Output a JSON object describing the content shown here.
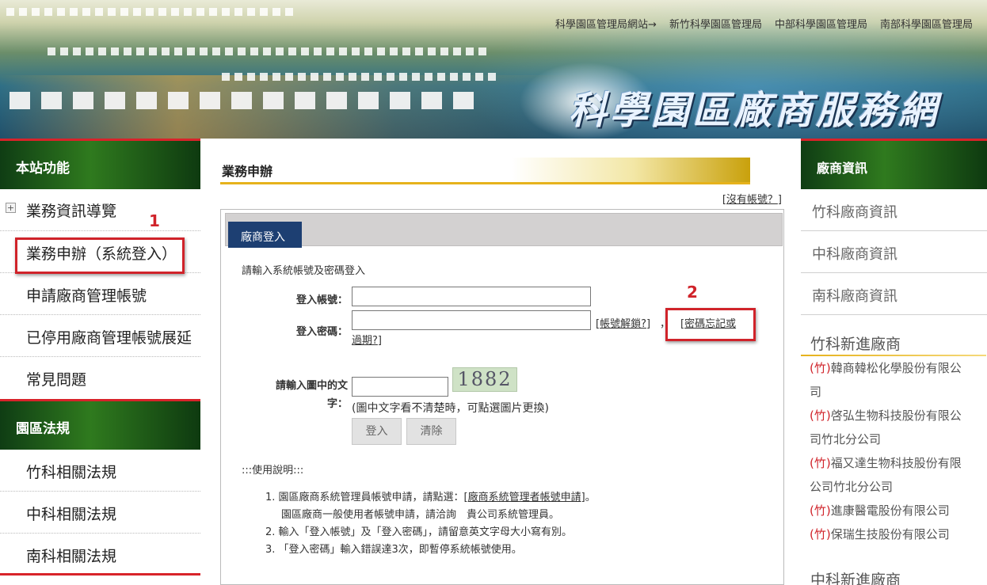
{
  "banner": {
    "brand_text": "科學園區廠商服務網",
    "top_links": [
      "科學園區管理局網站→",
      "新竹科學園區管理局",
      "中部科學園區管理局",
      "南部科學園區管理局"
    ]
  },
  "left": {
    "section1_title": "本站功能",
    "items": [
      {
        "label": "業務資訊導覽"
      },
      {
        "label": "業務申辦（系統登入）"
      },
      {
        "label": "申請廠商管理帳號"
      },
      {
        "label": "已停用廠商管理帳號展延"
      },
      {
        "label": "常見問題"
      }
    ],
    "section2_title": "園區法規",
    "law_items": [
      {
        "label": "竹科相關法規"
      },
      {
        "label": "中科相關法規"
      },
      {
        "label": "南科相關法規"
      }
    ]
  },
  "annotations": {
    "step1": "1",
    "step2": "2"
  },
  "main": {
    "title": "業務申辦",
    "no_account_link": "沒有帳號？",
    "tab_label": "廠商登入",
    "intro": "請輸入系統帳號及密碼登入",
    "account_label": "登入帳號：",
    "password_label": "登入密碼：",
    "unlock_link": "帳號解鎖?",
    "forgot_link_a": "密碼忘記或",
    "forgot_link_b": "過期?",
    "captcha_label_a": "請輸入圖中的文",
    "captcha_label_b": "字：",
    "captcha_text": "1882",
    "captcha_hint": "(圖中文字看不清楚時，可點選圖片更換)",
    "login_button": "登入",
    "clear_button": "清除",
    "usage_title": ":::使用說明:::",
    "usage_1a": "1. 園區廠商系統管理員帳號申請，請點選：[",
    "usage_1_link": "廠商系統管理者帳號申請",
    "usage_1b": "]。",
    "usage_1c": "園區廠商一般使用者帳號申請，請洽詢　貴公司系統管理員。",
    "usage_2": "2. 輸入「登入帳號」及「登入密碼」，請留意英文字母大小寫有別。",
    "usage_3": "3. 「登入密碼」輸入錯誤達3次，即暫停系統帳號使用。"
  },
  "right": {
    "title": "廠商資訊",
    "items": [
      {
        "label": "竹科廠商資訊"
      },
      {
        "label": "中科廠商資訊"
      },
      {
        "label": "南科廠商資訊"
      }
    ],
    "new_hsinchu_title": "竹科新進廠商",
    "companies": [
      {
        "tag": "(竹)",
        "name": "韓商韓松化學股份有限公",
        "name2": "司"
      },
      {
        "tag": "(竹)",
        "name": "啓弘生物科技股份有限公",
        "name2": "司竹北分公司"
      },
      {
        "tag": "(竹)",
        "name": "福又達生物科技股份有限",
        "name2": "公司竹北分公司"
      },
      {
        "tag": "(竹)",
        "name": "進康醫電股份有限公司",
        "name2": ""
      },
      {
        "tag": "(竹)",
        "name": "保瑞生技股份有限公司",
        "name2": ""
      }
    ],
    "new_central_title": "中科新進廠商"
  }
}
